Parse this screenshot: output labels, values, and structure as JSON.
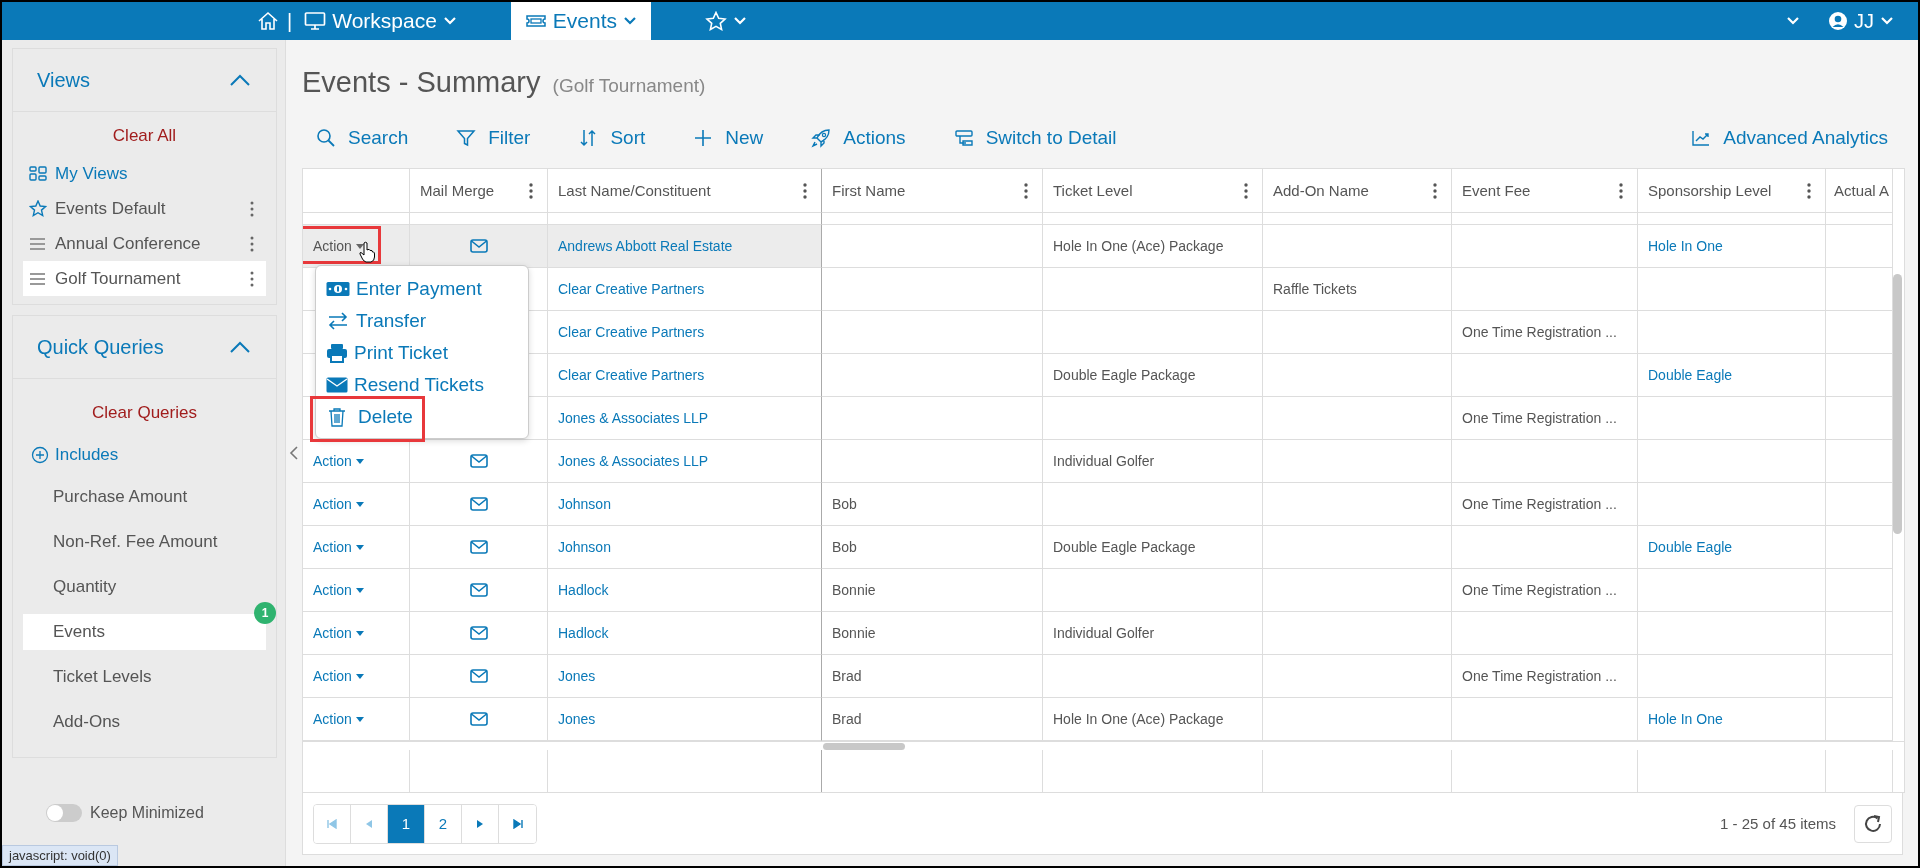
{
  "topbar": {
    "separator": "|",
    "nav": [
      {
        "kind": "workspace",
        "label": "Workspace",
        "selected": false
      },
      {
        "kind": "events",
        "label": "Events",
        "selected": true
      },
      {
        "kind": "favorites",
        "selected": false
      }
    ],
    "user": {
      "initials": "JJ"
    }
  },
  "sidebar": {
    "views": {
      "title": "Views",
      "expanded": true,
      "clear": "Clear All",
      "items": [
        {
          "kind": "grid",
          "label": "My Views",
          "selected": false
        },
        {
          "kind": "star",
          "label": "Events Default",
          "selected": false
        },
        {
          "kind": "saved",
          "label": "Annual Conference",
          "selected": false
        },
        {
          "kind": "saved",
          "label": "Golf Tournament",
          "selected": true
        }
      ]
    },
    "queries": {
      "title": "Quick Queries",
      "expanded": true,
      "clear": "Clear Queries",
      "include": "Includes",
      "items": [
        {
          "label": "Purchase Amount",
          "selected": false
        },
        {
          "label": "Non-Ref. Fee Amount",
          "selected": false
        },
        {
          "label": "Quantity",
          "selected": false
        },
        {
          "label": "Events",
          "selected": true,
          "badge": "1"
        },
        {
          "label": "Ticket Levels",
          "selected": false
        },
        {
          "label": "Add-Ons",
          "selected": false
        }
      ]
    },
    "keep_minimized": {
      "label": "Keep Minimized",
      "on": false
    },
    "status": "javascript: void(0)"
  },
  "page": {
    "title": "Events - Summary",
    "subtitle": "(Golf Tournament)"
  },
  "toolbar": [
    {
      "kind": "search",
      "label": "Search"
    },
    {
      "kind": "filter",
      "label": "Filter"
    },
    {
      "kind": "sort",
      "label": "Sort"
    },
    {
      "kind": "new",
      "label": "New"
    },
    {
      "kind": "actions",
      "label": "Actions"
    },
    {
      "kind": "switch",
      "label": "Switch to Detail"
    }
  ],
  "analytics": {
    "label": "Advanced Analytics"
  },
  "table": {
    "columns": [
      {
        "kind": "action"
      },
      {
        "kind": "mail",
        "label": "Mail Merge"
      },
      {
        "kind": "last_name",
        "label": "Last Name/Constituent"
      },
      {
        "kind": "first_name",
        "label": "First Name"
      },
      {
        "kind": "ticket_level",
        "label": "Ticket Level"
      },
      {
        "kind": "addon",
        "label": "Add-On Name"
      },
      {
        "kind": "event_fee",
        "label": "Event Fee"
      },
      {
        "kind": "sponsorship",
        "label": "Sponsorship Level"
      },
      {
        "kind": "cut",
        "label": "Actual A"
      }
    ],
    "rows": [
      {
        "selected": true,
        "highlighted": true,
        "action": "Action",
        "mail": true,
        "last_name": "Andrews Abbott Real Estate",
        "ticket_level": "Hole In One (Ace) Package",
        "sponsorship": "Hole In One"
      },
      {
        "selected": false,
        "last_name": "Clear Creative Partners",
        "addon": "Raffle Tickets"
      },
      {
        "selected": false,
        "last_name": "Clear Creative Partners",
        "event_fee": "One Time Registration ..."
      },
      {
        "selected": false,
        "last_name": "Clear Creative Partners",
        "ticket_level": "Double Eagle Package",
        "sponsorship": "Double Eagle"
      },
      {
        "selected": false,
        "last_name": "Jones & Associates LLP",
        "event_fee": "One Time Registration ..."
      },
      {
        "selected": false,
        "highlighted": false,
        "action": "Action",
        "mail": true,
        "last_name": "Jones & Associates LLP",
        "ticket_level": "Individual Golfer"
      },
      {
        "selected": false,
        "highlighted": false,
        "action": "Action",
        "mail": true,
        "last_name": "Johnson",
        "first_name": "Bob",
        "event_fee": "One Time Registration ..."
      },
      {
        "selected": false,
        "highlighted": false,
        "action": "Action",
        "mail": true,
        "last_name": "Johnson",
        "first_name": "Bob",
        "ticket_level": "Double Eagle Package",
        "sponsorship": "Double Eagle"
      },
      {
        "selected": false,
        "highlighted": false,
        "action": "Action",
        "mail": true,
        "last_name": "Hadlock",
        "first_name": "Bonnie",
        "event_fee": "One Time Registration ..."
      },
      {
        "selected": false,
        "highlighted": false,
        "action": "Action",
        "mail": true,
        "last_name": "Hadlock",
        "first_name": "Bonnie",
        "ticket_level": "Individual Golfer"
      },
      {
        "selected": false,
        "highlighted": false,
        "action": "Action",
        "mail": true,
        "last_name": "Jones",
        "first_name": "Brad",
        "event_fee": "One Time Registration ..."
      },
      {
        "selected": false,
        "highlighted": false,
        "action": "Action",
        "mail": true,
        "last_name": "Jones",
        "first_name": "Brad",
        "ticket_level": "Hole In One (Ace) Package",
        "sponsorship": "Hole In One"
      }
    ]
  },
  "menu": {
    "items": [
      {
        "kind": "payment",
        "label": "Enter Payment",
        "highlighted": false
      },
      {
        "kind": "transfer",
        "label": "Transfer",
        "highlighted": false
      },
      {
        "kind": "print",
        "label": "Print Ticket",
        "highlighted": false
      },
      {
        "kind": "resend",
        "label": "Resend Tickets",
        "highlighted": false
      },
      {
        "kind": "delete",
        "label": "Delete",
        "highlighted": true
      }
    ]
  },
  "pager": {
    "pages": [
      {
        "label": "1",
        "selected": true
      },
      {
        "label": "2",
        "selected": false
      }
    ],
    "summary": "1 - 25 of 45 items"
  }
}
